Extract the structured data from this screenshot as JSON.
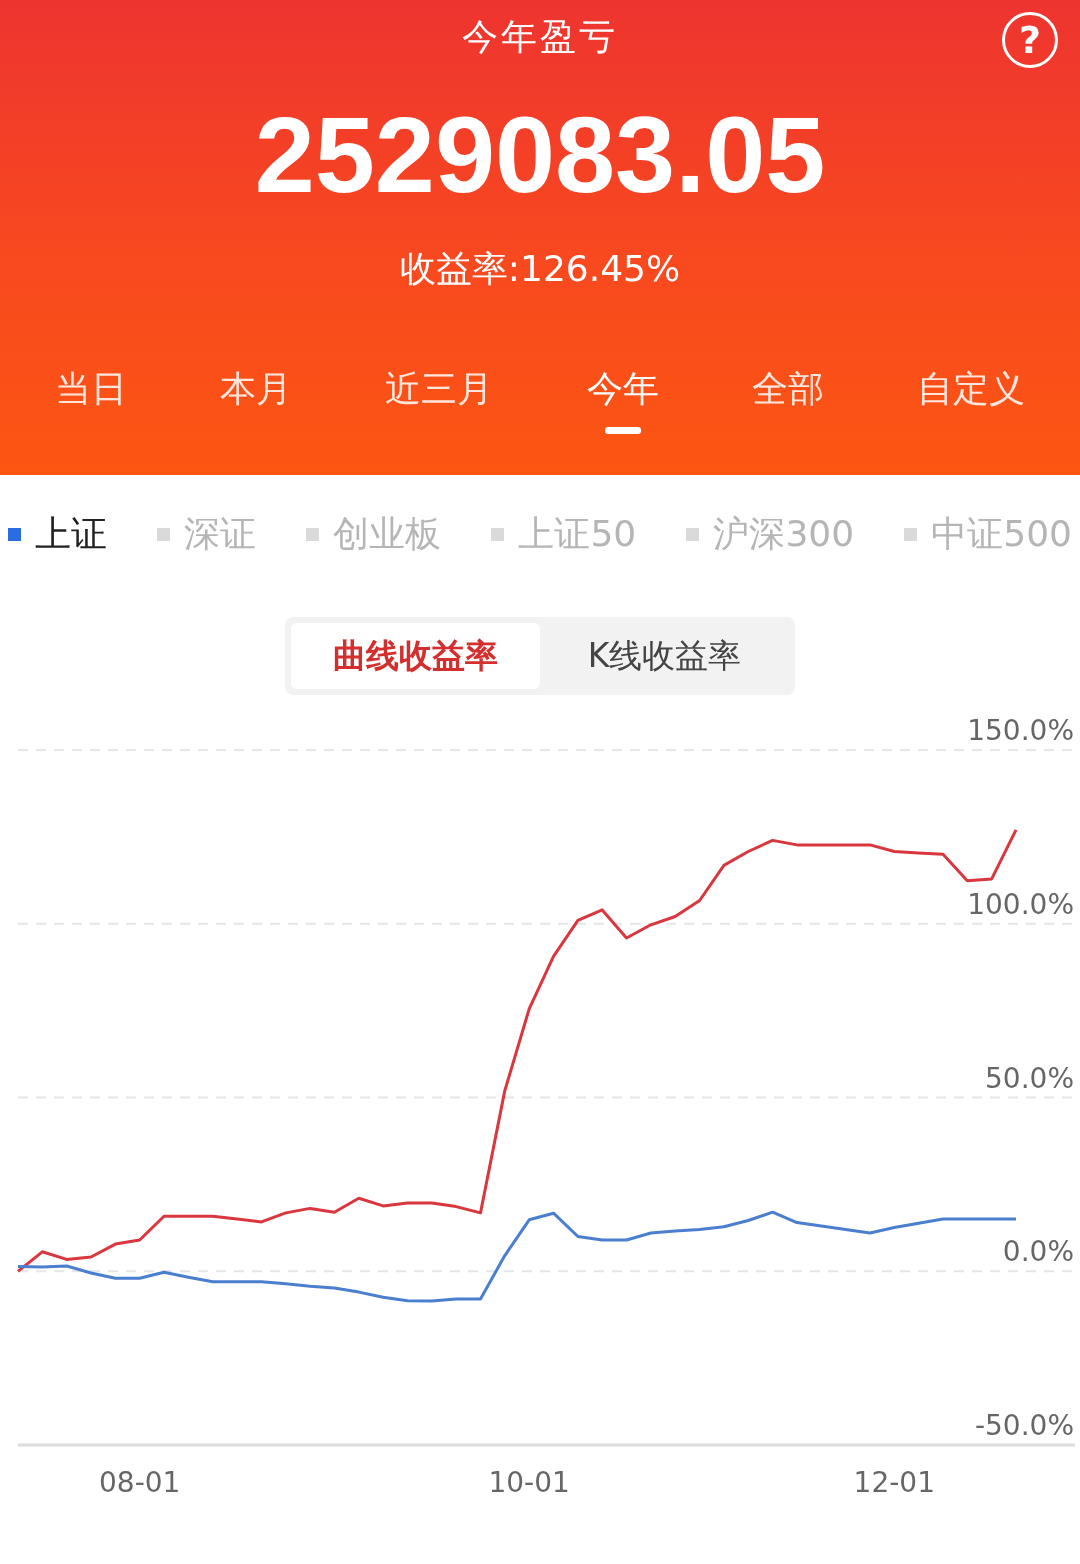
{
  "header": {
    "title": "今年盈亏",
    "help": "?",
    "amount": "2529083.05",
    "yield": "收益率:126.45%"
  },
  "periods": [
    {
      "label": "当日",
      "selected": false
    },
    {
      "label": "本月",
      "selected": false
    },
    {
      "label": "近三月",
      "selected": false
    },
    {
      "label": "今年",
      "selected": true
    },
    {
      "label": "全部",
      "selected": false
    },
    {
      "label": "自定义",
      "selected": false
    }
  ],
  "indices": [
    {
      "label": "上证",
      "selected": true
    },
    {
      "label": "深证",
      "selected": false
    },
    {
      "label": "创业板",
      "selected": false
    },
    {
      "label": "上证50",
      "selected": false
    },
    {
      "label": "沪深300",
      "selected": false
    },
    {
      "label": "中证500",
      "selected": false
    }
  ],
  "modes": [
    {
      "label": "曲线收益率",
      "selected": true
    },
    {
      "label": "K线收益率",
      "selected": false
    }
  ],
  "chart_data": {
    "type": "line",
    "categories": [
      null,
      null,
      null,
      null,
      null,
      "08-01",
      null,
      null,
      null,
      null,
      null,
      null,
      null,
      null,
      null,
      null,
      null,
      null,
      null,
      null,
      null,
      "10-01",
      null,
      null,
      null,
      null,
      null,
      null,
      null,
      null,
      null,
      null,
      null,
      null,
      null,
      null,
      "12-01",
      null,
      null,
      null,
      null,
      null
    ],
    "series": [
      {
        "color": "#d9363e",
        "values": [
          0,
          5.6,
          3.4,
          4.1,
          7.8,
          9,
          15.8,
          15.8,
          15.8,
          15,
          14.2,
          16.8,
          18.1,
          17,
          21,
          18.8,
          19.6,
          19.6,
          18.6,
          16.8,
          52,
          75.5,
          90.6,
          101,
          104,
          95.9,
          99.7,
          102.1,
          106.7,
          116.8,
          120.8,
          124,
          122.7,
          122.7,
          122.7,
          122.7,
          120.8,
          120.4,
          120,
          112.4,
          112.9,
          127
        ]
      },
      {
        "color": "#4a7fd0",
        "values": [
          1.4,
          1.2,
          1.5,
          -0.5,
          -2,
          -2,
          -0.3,
          -1.7,
          -3,
          -3,
          -3,
          -3.6,
          -4.3,
          -4.8,
          -6,
          -7.5,
          -8.5,
          -8.6,
          -8,
          -8,
          4.5,
          14.8,
          16.7,
          10,
          9,
          9,
          11,
          11.6,
          12,
          12.8,
          14.6,
          17,
          14,
          13,
          12,
          11,
          12.6,
          13.8,
          15,
          15,
          15,
          15
        ]
      }
    ],
    "ylim": [
      -50,
      150
    ],
    "grid": true,
    "yticks": [
      {
        "value": 150,
        "label": "150.0%"
      },
      {
        "value": 100,
        "label": "100.0%"
      },
      {
        "value": 50,
        "label": "50.0%"
      },
      {
        "value": 0,
        "label": "0.0%"
      },
      {
        "value": -50,
        "label": "-50.0%"
      }
    ]
  }
}
